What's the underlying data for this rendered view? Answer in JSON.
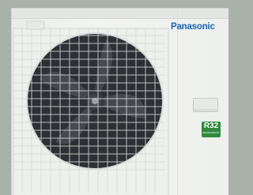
{
  "brand": {
    "logo_text": "Panasonic",
    "color": "#1664b4"
  },
  "refrigerant_badge": {
    "main": "R32",
    "sub": "REFRIGERANT",
    "color": "#2f8a3e"
  },
  "icons": [
    "fan-icon",
    "handle-icon"
  ]
}
